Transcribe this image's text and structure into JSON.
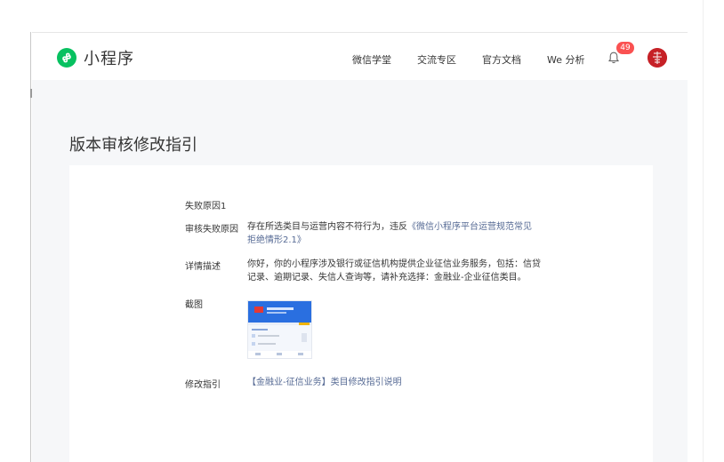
{
  "header": {
    "logo_text": "小程序",
    "nav": [
      "微信学堂",
      "交流专区",
      "官方文档",
      "We 分析"
    ],
    "notification_count": "49"
  },
  "page": {
    "title": "版本审核修改指引"
  },
  "detail": {
    "section_title": "失败原因1",
    "reason_label": "审核失败原因",
    "reason_text": "存在所选类目与运营内容不符行为，违反",
    "reason_link_line1": "《微信小程序平台运营规范常见",
    "reason_link_line2": "拒绝情形2.1》",
    "desc_label": "详情描述",
    "desc_line1": "你好，你的小程序涉及银行或征信机构提供企业征信业务服务，包括：信贷",
    "desc_line2": "记录、逾期记录、失信人查询等，请补充选择：金融业-企业征信类目。",
    "screenshot_label": "截图",
    "guide_label": "修改指引",
    "guide_link": "【金融业-征信业务】类目修改指引说明"
  },
  "colors": {
    "brand_green": "#07c160",
    "link": "#576b95",
    "badge": "#fa5151"
  }
}
